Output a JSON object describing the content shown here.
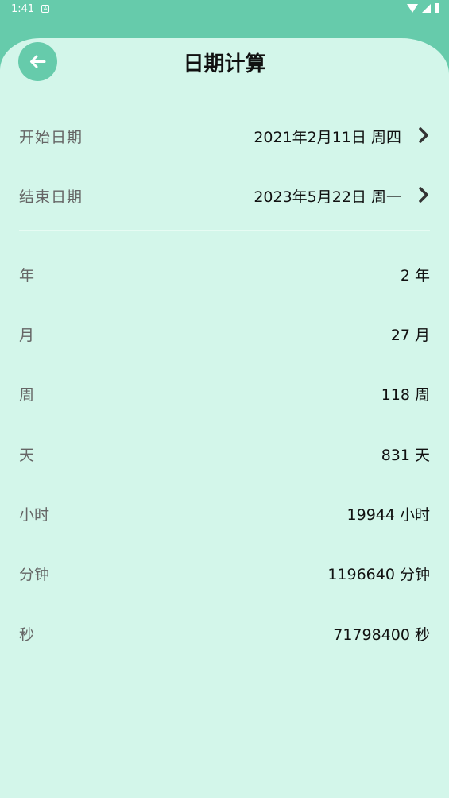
{
  "status_bar": {
    "time": "1:41",
    "notification_glyph": "A"
  },
  "header": {
    "title": "日期计算"
  },
  "dates": [
    {
      "label": "开始日期",
      "value": "2021年2月11日 周四"
    },
    {
      "label": "结束日期",
      "value": "2023年5月22日 周一"
    }
  ],
  "results": [
    {
      "label": "年",
      "value": "2 年"
    },
    {
      "label": "月",
      "value": "27 月"
    },
    {
      "label": "周",
      "value": "118 周"
    },
    {
      "label": "天",
      "value": "831 天"
    },
    {
      "label": "小时",
      "value": "19944 小时"
    },
    {
      "label": "分钟",
      "value": "1196640 分钟"
    },
    {
      "label": "秒",
      "value": "71798400 秒"
    }
  ],
  "colors": {
    "accent": "#66cbab",
    "background": "#d3f6ea"
  }
}
